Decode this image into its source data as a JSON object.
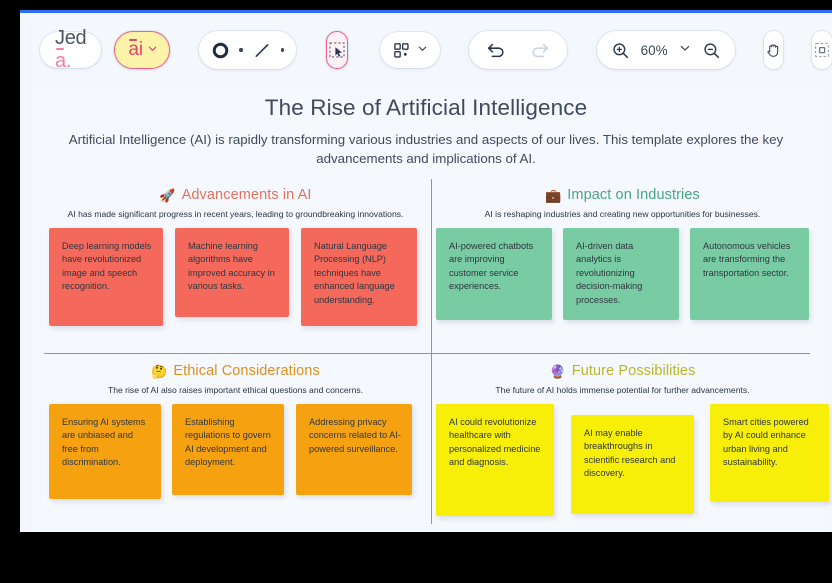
{
  "toolbar": {
    "logo": {
      "text_pre": "Jed",
      "text_a": "a",
      "text_dot": "."
    },
    "ai_button": {
      "label": "ai",
      "icon": "chevron-down-icon"
    },
    "shape_tools": {
      "circle": "circle-shape-icon",
      "line": "line-shape-icon"
    },
    "select_tool": {
      "icon": "select-marquee-icon"
    },
    "grid_tool": {
      "icon": "layout-grid-icon",
      "caret": "chevron-down-icon"
    },
    "undo": {
      "icon": "undo-arrow-icon"
    },
    "redo": {
      "icon": "redo-arrow-icon"
    },
    "zoom_in": {
      "icon": "zoom-in-icon"
    },
    "zoom_level": "60%",
    "zoom_caret": "chevron-down-icon",
    "zoom_out": {
      "icon": "zoom-out-icon"
    },
    "pan_tool": {
      "icon": "hand-pan-icon"
    },
    "frame_tool": {
      "icon": "frame-crop-icon"
    }
  },
  "deck": {
    "title": "The Rise of Artificial Intelligence",
    "subtitle": "Artificial Intelligence (AI) is rapidly transforming various industries and aspects of our lives. This template explores the key advancements and implications of AI."
  },
  "quadrants": [
    {
      "id": "advancements",
      "emoji": "🚀",
      "emoji_name": "rocket-icon",
      "title": "Advancements in AI",
      "title_color": "#e3725f",
      "description": "AI has made significant progress in recent years, leading to groundbreaking innovations.",
      "card_color": "#f4695b",
      "cards": [
        "Deep learning models have revolutionized image and speech recognition.",
        "Machine learning algorithms have improved accuracy in various tasks.",
        "Natural Language Processing (NLP) techniques have enhanced language understanding."
      ]
    },
    {
      "id": "impact",
      "emoji": "💼",
      "emoji_name": "briefcase-icon",
      "title": "Impact on Industries",
      "title_color": "#4aa582",
      "description": "AI is reshaping industries and creating new opportunities for businesses.",
      "card_color": "#79cba3",
      "cards": [
        "AI-powered chatbots are improving customer service experiences.",
        "AI-driven data analytics is revolutionizing decision-making processes.",
        "Autonomous vehicles are transforming the transportation sector."
      ]
    },
    {
      "id": "ethics",
      "emoji": "🤔",
      "emoji_name": "thinking-face-icon",
      "title": "Ethical Considerations",
      "title_color": "#dd8f21",
      "description": "The rise of AI also raises important ethical questions and concerns.",
      "card_color": "#f6a210",
      "cards": [
        "Ensuring AI systems are unbiased and free from discrimination.",
        "Establishing regulations to govern AI development and deployment.",
        "Addressing privacy concerns related to AI-powered surveillance."
      ]
    },
    {
      "id": "future",
      "emoji": "🔮",
      "emoji_name": "crystal-ball-icon",
      "title": "Future Possibilities",
      "title_color": "#b7b62c",
      "description": "The future of AI holds immense potential for further advancements.",
      "card_color": "#f7ef07",
      "cards": [
        "AI could revolutionize healthcare with personalized medicine and diagnosis.",
        "AI may enable breakthroughs in scientific research and discovery.",
        "Smart cities powered by AI could enhance urban living and sustainability."
      ]
    }
  ],
  "colors": {
    "accent_bar": "#2f6df6",
    "canvas_bg": "#f5f8fd",
    "brand_pink": "#f0638a",
    "divider": "#8a95a6"
  }
}
